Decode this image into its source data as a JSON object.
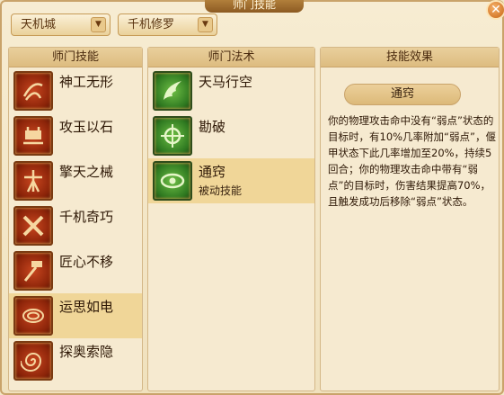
{
  "window": {
    "title": "师门技能",
    "close_glyph": "✕"
  },
  "dropdowns": [
    {
      "value": "天机城",
      "arrow": "▼"
    },
    {
      "value": "千机修罗",
      "arrow": "▼"
    }
  ],
  "left_panel": {
    "header": "师门技能",
    "skills": [
      {
        "name": "神工无形",
        "icon": "gear-swirl-icon"
      },
      {
        "name": "攻玉以石",
        "icon": "jade-crush-icon"
      },
      {
        "name": "擎天之械",
        "icon": "tower-mechanism-icon"
      },
      {
        "name": "千机奇巧",
        "icon": "cross-tools-icon"
      },
      {
        "name": "匠心不移",
        "icon": "hammer-icon"
      },
      {
        "name": "运思如电",
        "icon": "vortex-icon"
      },
      {
        "name": "探奥索隐",
        "icon": "spiral-icon"
      }
    ],
    "selected_index": 5
  },
  "middle_panel": {
    "header": "师门法术",
    "spells": [
      {
        "name": "天马行空",
        "sub": "",
        "icon": "wing-icon"
      },
      {
        "name": "勘破",
        "sub": "",
        "icon": "crosshair-icon"
      },
      {
        "name": "通窍",
        "sub": "被动技能",
        "icon": "eye-icon"
      }
    ],
    "selected_index": 2
  },
  "right_panel": {
    "header": "技能效果",
    "effect_name": "通窍",
    "description": "你的物理攻击命中没有“弱点”状态的目标时，有10%几率附加“弱点”，偃甲状态下此几率增加至20%，持续5回合；你的物理攻击命中带有“弱点”的目标时，伤害结果提高70%，且触发成功后移除“弱点”状态。"
  },
  "colors": {
    "accent": "#c9a36a",
    "selected": "#f0d698",
    "skill_icon": "#a8361a",
    "spell_icon": "#3f8a2a"
  }
}
